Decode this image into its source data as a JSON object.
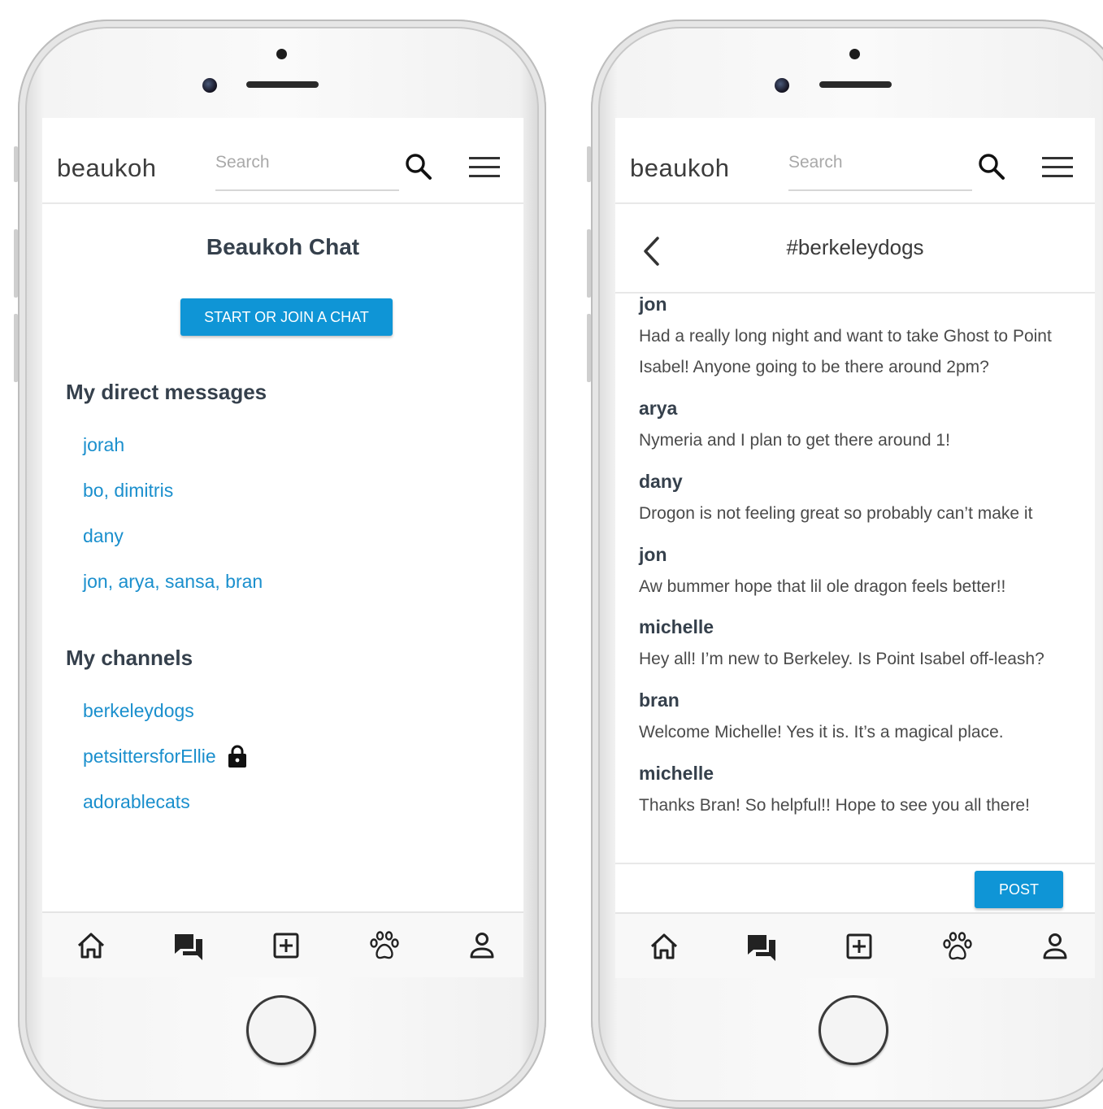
{
  "app": {
    "brand": "beaukoh",
    "search_placeholder": "Search"
  },
  "colors": {
    "accent": "#0f95d6",
    "link": "#1a8fcd",
    "heading": "#35404c"
  },
  "left_screen": {
    "title": "Beaukoh Chat",
    "start_button": "START OR JOIN A CHAT",
    "direct_messages_heading": "My direct messages",
    "direct_messages": [
      {
        "label": "jorah"
      },
      {
        "label": "bo, dimitris"
      },
      {
        "label": "dany"
      },
      {
        "label": "jon, arya, sansa, bran"
      }
    ],
    "channels_heading": "My channels",
    "channels": [
      {
        "label": "berkeleydogs",
        "locked": false
      },
      {
        "label": "petsittersforEllie",
        "locked": true
      },
      {
        "label": "adorablecats",
        "locked": false
      }
    ]
  },
  "right_screen": {
    "channel_title": "#berkeleydogs",
    "messages": [
      {
        "author": "jon",
        "text": "Had a really long night and want to take Ghost to Point Isabel! Anyone going to be there around 2pm?"
      },
      {
        "author": "arya",
        "text": "Nymeria and I plan to get there around 1!"
      },
      {
        "author": "dany",
        "text": "Drogon is not feeling great so probably can’t make it"
      },
      {
        "author": "jon",
        "text": "Aw bummer hope that lil ole dragon feels better!!"
      },
      {
        "author": "michelle",
        "text": "Hey all! I’m new to Berkeley. Is Point Isabel off-leash?"
      },
      {
        "author": "bran",
        "text": "Welcome Michelle! Yes it is. It’s a magical place."
      },
      {
        "author": "michelle",
        "text": "Thanks Bran! So helpful!! Hope to see you all there!"
      }
    ],
    "post_button": "POST"
  },
  "bottom_nav": [
    {
      "icon": "home-icon"
    },
    {
      "icon": "chat-icon"
    },
    {
      "icon": "add-icon"
    },
    {
      "icon": "paw-icon"
    },
    {
      "icon": "profile-icon"
    }
  ]
}
